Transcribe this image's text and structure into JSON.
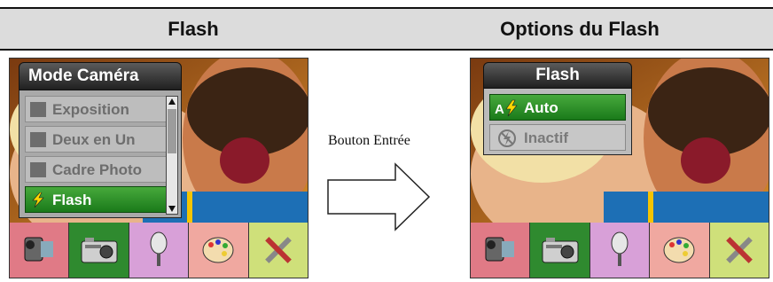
{
  "headers": {
    "left": "Flash",
    "right": "Options du Flash"
  },
  "left_screen": {
    "menu_title": "Mode Caméra",
    "items": [
      {
        "label": "Exposition",
        "icon": "exposure-icon",
        "selected": false
      },
      {
        "label": "Deux en Un",
        "icon": "two-in-one-icon",
        "selected": false
      },
      {
        "label": "Cadre Photo",
        "icon": "photo-frame-icon",
        "selected": false
      },
      {
        "label": "Flash",
        "icon": "flash-icon",
        "selected": true
      }
    ]
  },
  "right_screen": {
    "menu_title": "Flash",
    "items": [
      {
        "label": "Auto",
        "icon": "flash-auto-icon",
        "selected": true
      },
      {
        "label": "Inactif",
        "icon": "flash-off-icon",
        "selected": false
      }
    ]
  },
  "mode_tray": [
    "video-camera-icon",
    "camera-icon",
    "microphone-icon",
    "palette-icon",
    "tools-icon"
  ],
  "transition": {
    "caption": "Bouton Entrée",
    "icon": "right-arrow-icon"
  },
  "colors": {
    "selected_green": "#2e8b2e",
    "header_band": "#dcdcdc",
    "menu_title_dark": "#2b2b2b"
  }
}
